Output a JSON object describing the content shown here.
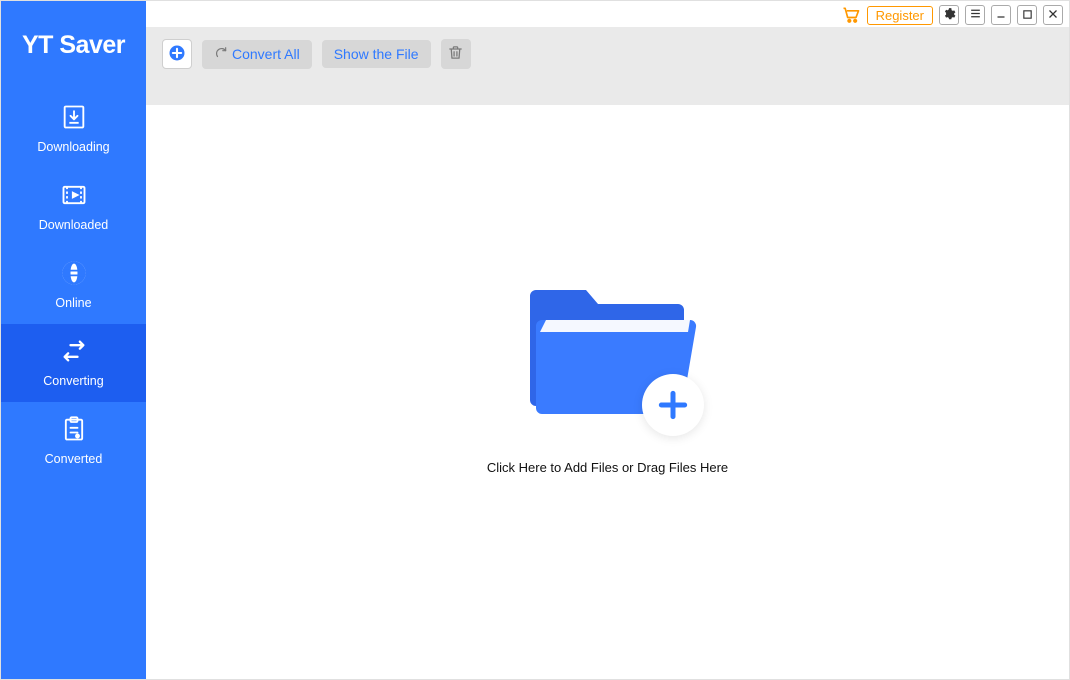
{
  "app": {
    "title": "YT Saver"
  },
  "sidebar": {
    "items": [
      {
        "label": "Downloading"
      },
      {
        "label": "Downloaded"
      },
      {
        "label": "Online"
      },
      {
        "label": "Converting"
      },
      {
        "label": "Converted"
      }
    ]
  },
  "toolbar": {
    "convert_all": "Convert All",
    "show_file": "Show the File"
  },
  "titlebar": {
    "register": "Register"
  },
  "content": {
    "drop_text": "Click Here to Add Files or Drag Files Here"
  }
}
